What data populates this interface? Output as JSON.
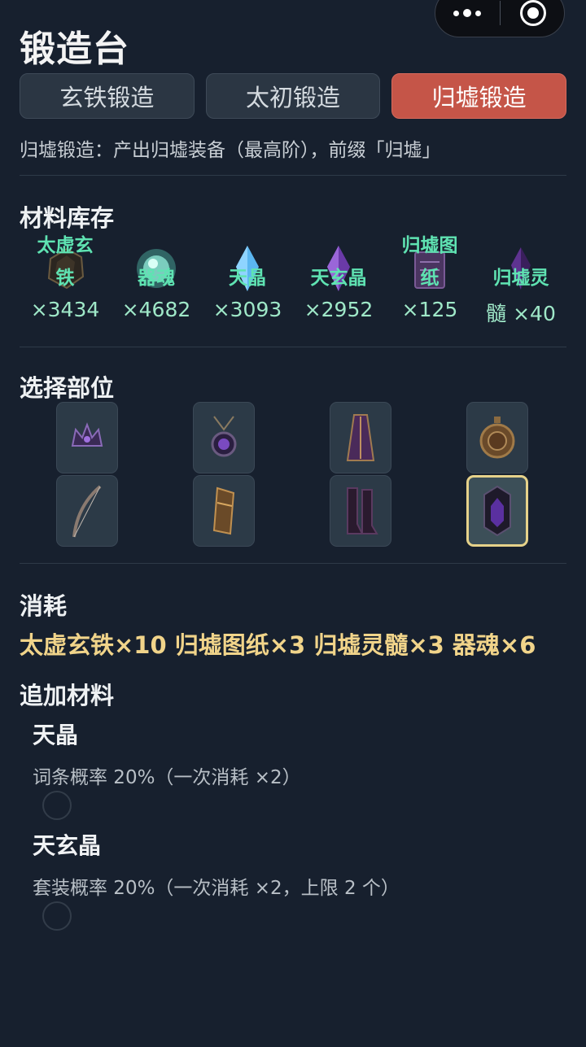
{
  "title": "锻造台",
  "tabs": [
    {
      "label": "玄铁锻造"
    },
    {
      "label": "太初锻造"
    },
    {
      "label": "归墟锻造"
    }
  ],
  "description": "归墟锻造：产出归墟装备（最高阶），前缀「归墟」",
  "materials_section": {
    "title": "材料库存",
    "items": [
      {
        "name_line1": "太虚玄",
        "name_line2": "铁",
        "count": "×3434",
        "icon": "dark-ore-icon"
      },
      {
        "name_line1": "",
        "name_line2": "器魂",
        "count": "×4682",
        "icon": "glowing-orb-icon"
      },
      {
        "name_line1": "",
        "name_line2": "天晶",
        "count": "×3093",
        "icon": "blue-crystal-icon"
      },
      {
        "name_line1": "",
        "name_line2": "天玄晶",
        "count": "×2952",
        "icon": "purple-crystal-icon"
      },
      {
        "name_line1": "归墟图",
        "name_line2": "纸",
        "count": "×125",
        "icon": "scroll-icon"
      },
      {
        "name_line1": "",
        "name_line2": "归墟灵",
        "count": "髓 ×40",
        "icon": "dark-crystal-icon"
      }
    ]
  },
  "slot_section": {
    "title": "选择部位",
    "slots": [
      {
        "icon": "crown-icon"
      },
      {
        "icon": "amulet-icon"
      },
      {
        "icon": "robe-icon"
      },
      {
        "icon": "compass-icon"
      },
      {
        "icon": "bow-icon"
      },
      {
        "icon": "gauntlet-icon"
      },
      {
        "icon": "boots-icon"
      },
      {
        "icon": "shield-icon"
      }
    ]
  },
  "cost_section": {
    "title": "消耗",
    "text": "太虚玄铁×10  归墟图纸×3  归墟灵髓×3  器魂×6"
  },
  "extra_section": {
    "title": "追加材料",
    "items": [
      {
        "name": "天晶",
        "desc": "词条概率 20%（一次消耗 ×2）"
      },
      {
        "name": "天玄晶",
        "desc": "套装概率 20%（一次消耗 ×2，上限 2 个）"
      }
    ]
  },
  "colors": {
    "background": "#17202e",
    "active_tab": "#c55548",
    "material_text": "#5fe3b2",
    "cost_text": "#f1d48a",
    "selected_border": "#e6d28a"
  }
}
